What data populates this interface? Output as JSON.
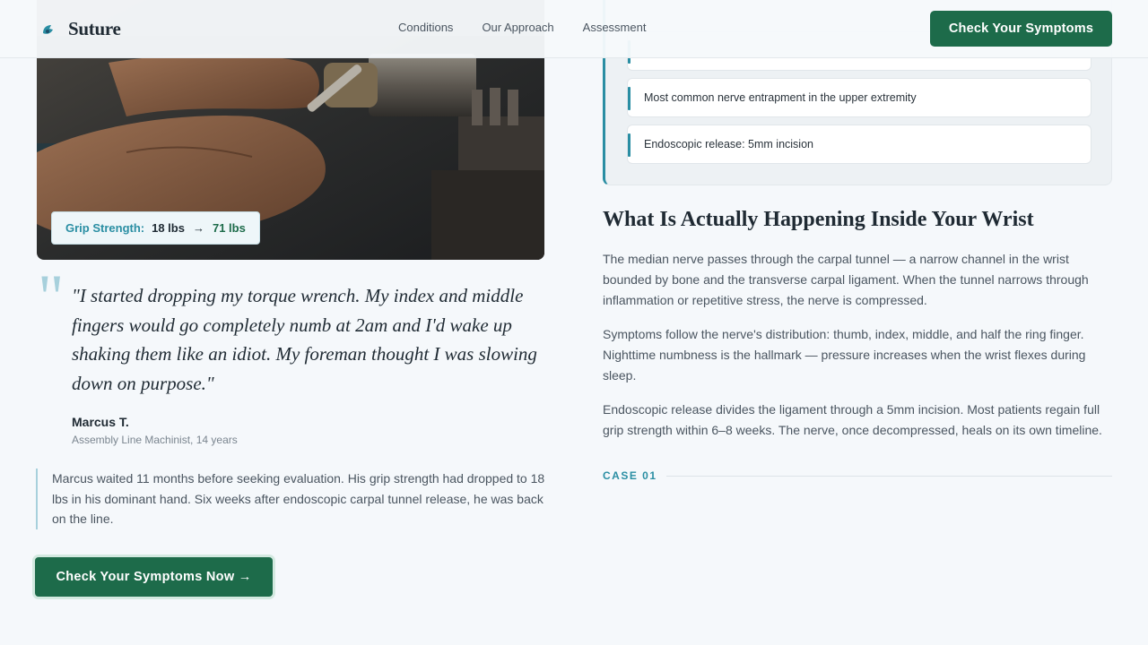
{
  "header": {
    "brand": "Suture",
    "nav": [
      "Conditions",
      "Our Approach",
      "Assessment"
    ],
    "cta": "Check Your Symptoms"
  },
  "photo": {
    "grip_label": "Grip Strength:",
    "grip_from": "18 lbs",
    "grip_arrow": "→",
    "grip_to": "71 lbs"
  },
  "testimonial": {
    "quote": "\"I started dropping my torque wrench. My index and middle fingers would go completely numb at 2am and I'd wake up shaking them like an idiot. My foreman thought I was slowing down on purpose.\"",
    "name": "Marcus T.",
    "role": "Assembly Line Machinist, 14 years"
  },
  "story": "Marcus waited 11 months before seeking evaluation. His grip strength had dropped to 18 lbs in his dominant hand. Six weeks after endoscopic carpal tunnel release, he was back on the line.",
  "cta_main": "Check Your Symptoms Now →",
  "facts": [
    "",
    "Most common nerve entrapment in the upper extremity",
    "Endoscopic release: 5mm incision"
  ],
  "article": {
    "title": "What Is Actually Happening Inside Your Wrist",
    "paragraphs": [
      "The median nerve passes through the carpal tunnel — a narrow channel in the wrist bounded by bone and the transverse carpal ligament. When the tunnel narrows through inflammation or repetitive stress, the nerve is compressed.",
      "Symptoms follow the nerve's distribution: thumb, index, middle, and half the ring finger. Nighttime numbness is the hallmark — pressure increases when the wrist flexes during sleep.",
      "Endoscopic release divides the ligament through a 5mm incision. Most patients regain full grip strength within 6–8 weeks. The nerve, once decompressed, heals on its own timeline."
    ],
    "case_label": "CASE 01"
  },
  "colors": {
    "brand_green": "#1d6b4a",
    "accent_teal": "#2a8ea3",
    "background": "#f5f8fb"
  }
}
